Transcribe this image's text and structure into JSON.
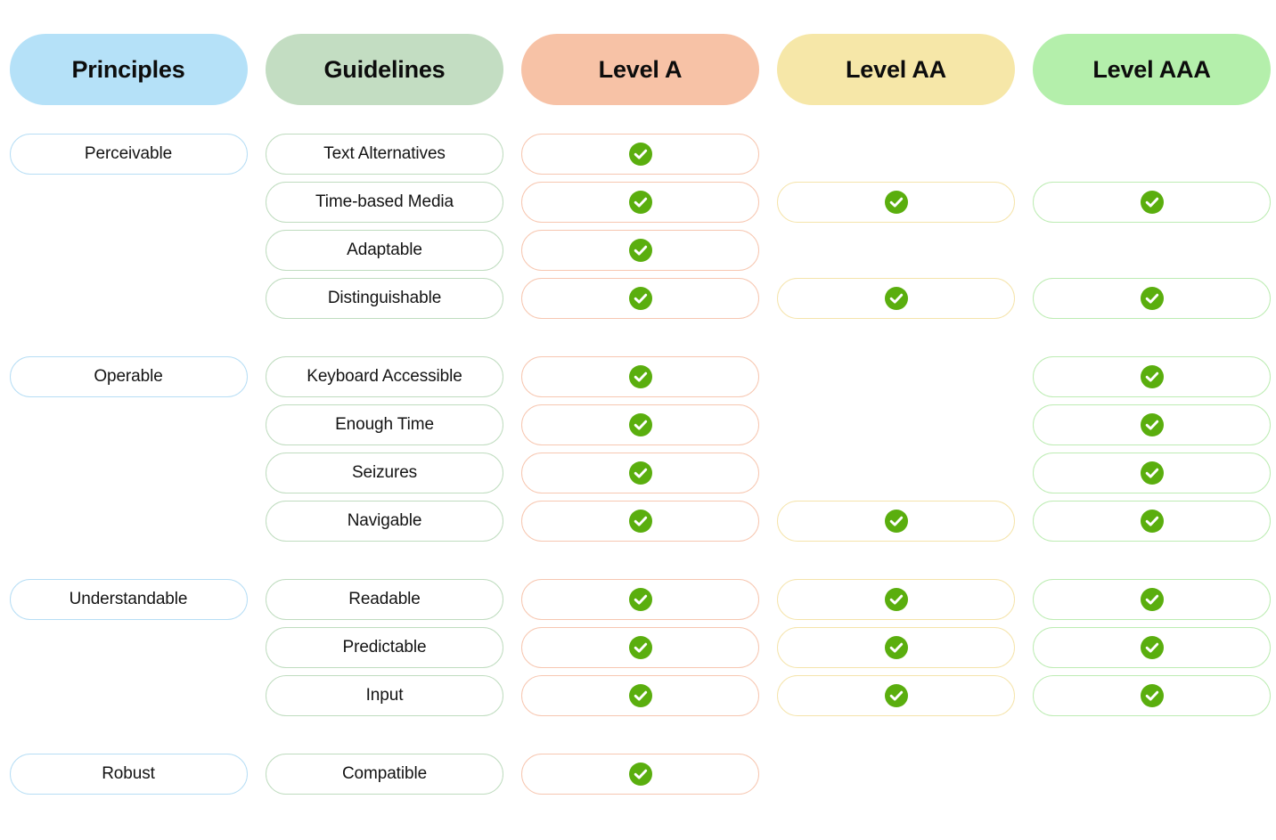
{
  "columns": [
    {
      "key": "principles",
      "label": "Principles",
      "header_bg": "#b5e1f8",
      "accent": "#b7def5"
    },
    {
      "key": "guidelines",
      "label": "Guidelines",
      "header_bg": "#c3ddc2",
      "accent": "#bfdcbf"
    },
    {
      "key": "level_a",
      "label": "Level A",
      "header_bg": "#f7c2a6",
      "accent": "#f7c7b1"
    },
    {
      "key": "level_aa",
      "label": "Level AA",
      "header_bg": "#f6e7a8",
      "accent": "#f5e4ab"
    },
    {
      "key": "level_aaa",
      "label": "Level AAA",
      "header_bg": "#b4efab",
      "accent": "#bdecb3"
    }
  ],
  "check_icon": "check-circle-icon",
  "check_color": "#5aae0e",
  "sections": [
    {
      "principle": "Perceivable",
      "rows": [
        {
          "guideline": "Text Alternatives",
          "level_a": true,
          "level_aa": false,
          "level_aaa": false
        },
        {
          "guideline": "Time-based Media",
          "level_a": true,
          "level_aa": true,
          "level_aaa": true
        },
        {
          "guideline": "Adaptable",
          "level_a": true,
          "level_aa": false,
          "level_aaa": false
        },
        {
          "guideline": "Distinguishable",
          "level_a": true,
          "level_aa": true,
          "level_aaa": true
        }
      ]
    },
    {
      "principle": "Operable",
      "rows": [
        {
          "guideline": "Keyboard Accessible",
          "level_a": true,
          "level_aa": false,
          "level_aaa": true
        },
        {
          "guideline": "Enough Time",
          "level_a": true,
          "level_aa": false,
          "level_aaa": true
        },
        {
          "guideline": "Seizures",
          "level_a": true,
          "level_aa": false,
          "level_aaa": true
        },
        {
          "guideline": "Navigable",
          "level_a": true,
          "level_aa": true,
          "level_aaa": true
        }
      ]
    },
    {
      "principle": "Understandable",
      "rows": [
        {
          "guideline": "Readable",
          "level_a": true,
          "level_aa": true,
          "level_aaa": true
        },
        {
          "guideline": "Predictable",
          "level_a": true,
          "level_aa": true,
          "level_aaa": true
        },
        {
          "guideline": "Input",
          "level_a": true,
          "level_aa": true,
          "level_aaa": true
        }
      ]
    },
    {
      "principle": "Robust",
      "rows": [
        {
          "guideline": "Compatible",
          "level_a": true,
          "level_aa": false,
          "level_aaa": false
        }
      ]
    }
  ]
}
